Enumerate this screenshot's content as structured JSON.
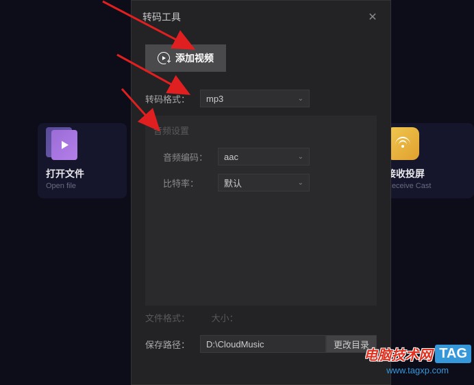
{
  "bg_cards": {
    "open_file": {
      "title": "打开文件",
      "sub": "Open file"
    },
    "receive_cast": {
      "title": "接收投屏",
      "sub": "Receive Cast"
    }
  },
  "dialog": {
    "title": "转码工具",
    "close": "✕",
    "add_video": "添加视频",
    "format_label": "转码格式：",
    "format_value": "mp3",
    "panel_title": "音频设置",
    "audio_codec_label": "音频编码：",
    "audio_codec_value": "aac",
    "bitrate_label": "比特率：",
    "bitrate_value": "默认",
    "file_format_label": "文件格式：",
    "size_label": "大小：",
    "save_path_label": "保存路径：",
    "save_path_value": "D:\\CloudMusic",
    "change_dir": "更改目录"
  },
  "watermark": {
    "cn": "电脑技术网",
    "tag": "TAG",
    "url": "www.tagxp.com"
  }
}
